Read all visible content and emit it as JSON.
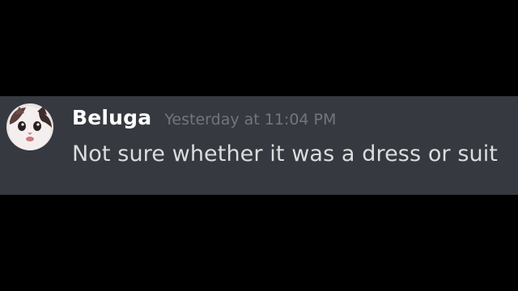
{
  "message": {
    "author": "Beluga",
    "timestamp": "Yesterday at 11:04 PM",
    "content": "Not sure whether it was a dress or suit",
    "avatar_icon": "cat-avatar-icon"
  },
  "colors": {
    "background": "#000000",
    "message_background": "#36393f",
    "username": "#ffffff",
    "timestamp": "#72767d",
    "content": "#dcddde"
  }
}
